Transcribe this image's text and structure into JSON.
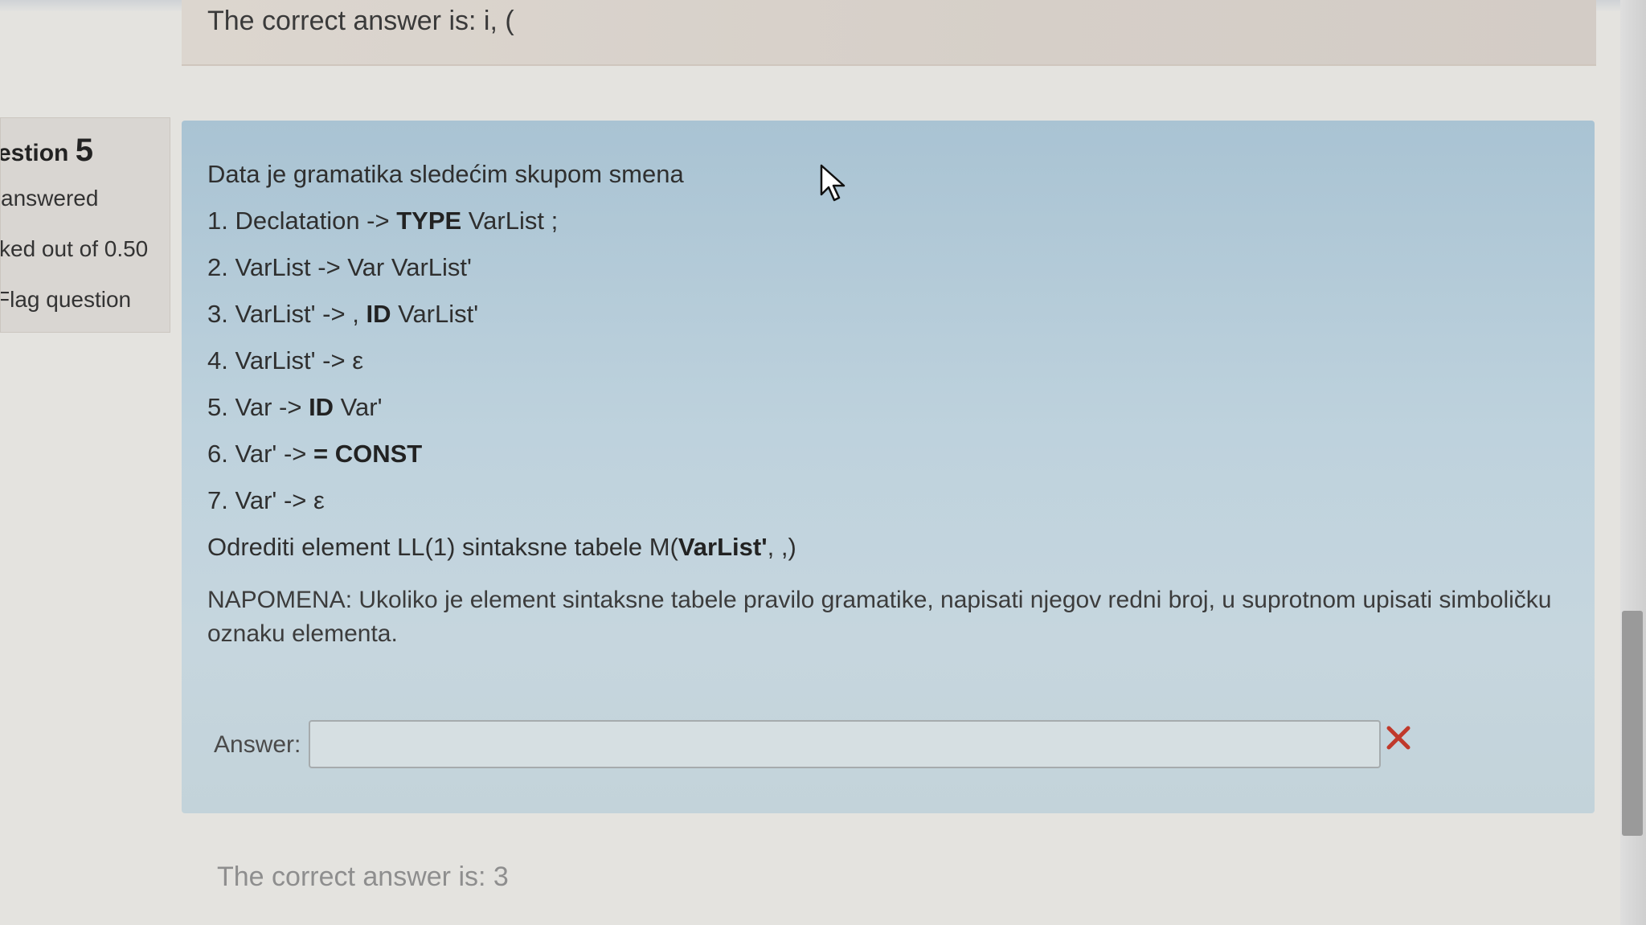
{
  "previous_feedback": {
    "text": "The correct answer is: i, ("
  },
  "question_info": {
    "question_label": "estion",
    "question_number": "5",
    "state": "answered",
    "grade": "ked out of 0.50",
    "flag": "Flag question"
  },
  "question": {
    "intro": "Data je gramatika sledećim skupom smena",
    "rules": [
      {
        "pre": "1. Declatation -> ",
        "bold": "TYPE",
        "post": " VarList ;"
      },
      {
        "pre": "2. VarList -> Var VarList'",
        "bold": "",
        "post": ""
      },
      {
        "pre": "3.  VarList' -> , ",
        "bold": "ID",
        "post": " VarList'"
      },
      {
        "pre": "4. VarList' -> ε",
        "bold": "",
        "post": ""
      },
      {
        "pre": "5. Var -> ",
        "bold": "ID",
        "post": " Var'"
      },
      {
        "pre": "6. Var' -> ",
        "bold": "= CONST",
        "post": ""
      },
      {
        "pre": "7.  Var' -> ε",
        "bold": "",
        "post": ""
      }
    ],
    "task_pre": "Odrediti element LL(1) sintaksne tabele M(",
    "task_bold": "VarList'",
    "task_post": ", ,)",
    "note": "NAPOMENA: Ukoliko je element sintaksne tabele pravilo gramatike, napisati njegov redni broj, u suprotnom upisati simboličku oznaku elementa."
  },
  "answer": {
    "label": "Answer:",
    "value": ""
  },
  "correct_answer": "The correct answer is: 3",
  "colors": {
    "question_bg": "#a9c3d3",
    "wrong_mark": "#c0392b",
    "info_bg": "#d9d6d2"
  },
  "icons": {
    "mark": "cross-icon",
    "pointer": "mouse-cursor-icon"
  }
}
